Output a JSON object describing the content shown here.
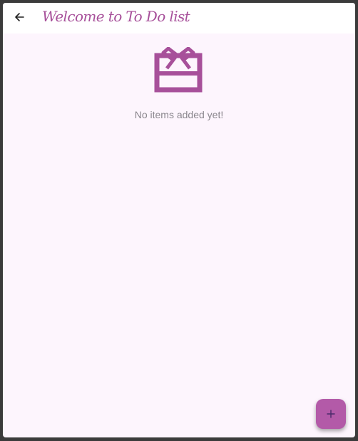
{
  "appbar": {
    "title": "Welcome to To Do list",
    "back_icon": "arrow-back-icon"
  },
  "empty_state": {
    "icon": "gift-card-icon",
    "message": "No items added yet!"
  },
  "fab": {
    "icon": "plus-icon"
  },
  "colors": {
    "accent": "#a7509a",
    "fab": "#b35aa8",
    "background": "#fdf5fd",
    "appbar": "#ffffff"
  }
}
